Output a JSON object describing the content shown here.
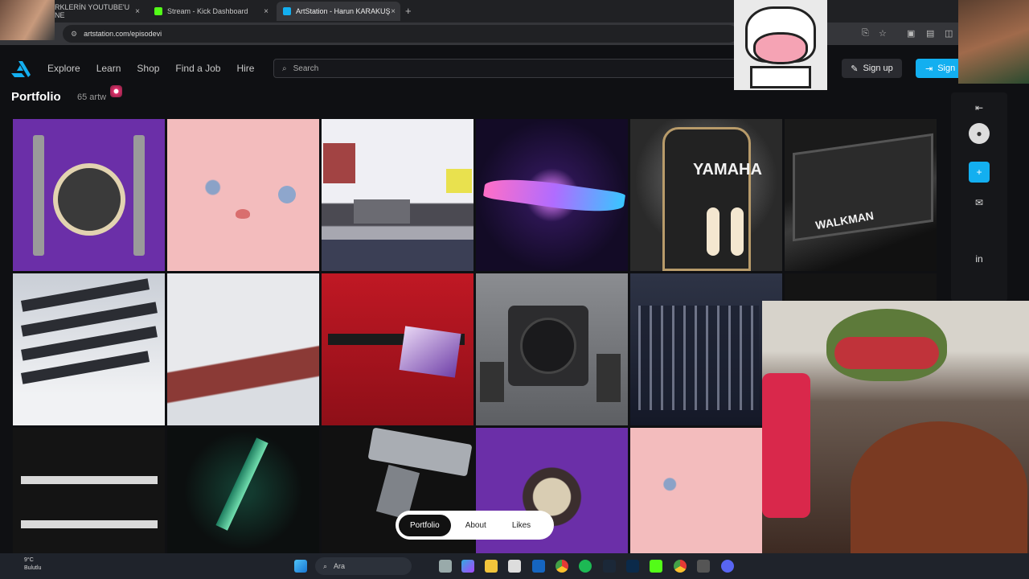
{
  "browser": {
    "tabs": [
      {
        "label": "RKLERİN YOUTUBE'U NE",
        "close": "×"
      },
      {
        "label": "Stream - Kick Dashboard",
        "close": "×"
      },
      {
        "label": "ArtStation - Harun KARAKUŞ",
        "close": "×"
      }
    ],
    "new_tab": "+",
    "url": "artstation.com/episodevi"
  },
  "header": {
    "nav": [
      "Explore",
      "Learn",
      "Shop",
      "Find a Job",
      "Hire"
    ],
    "search_placeholder": "Search",
    "signup": "Sign up",
    "signin": "Sign"
  },
  "portfolio": {
    "title": "Portfolio",
    "count": "65 artw"
  },
  "yamaha_label": "YAMAHA",
  "walkman_label": "WALKMAN",
  "profile_tabs": [
    "Portfolio",
    "About",
    "Likes"
  ],
  "taskbar": {
    "temp": "9°C",
    "weather": "Bulutlu",
    "search": "Ara"
  }
}
